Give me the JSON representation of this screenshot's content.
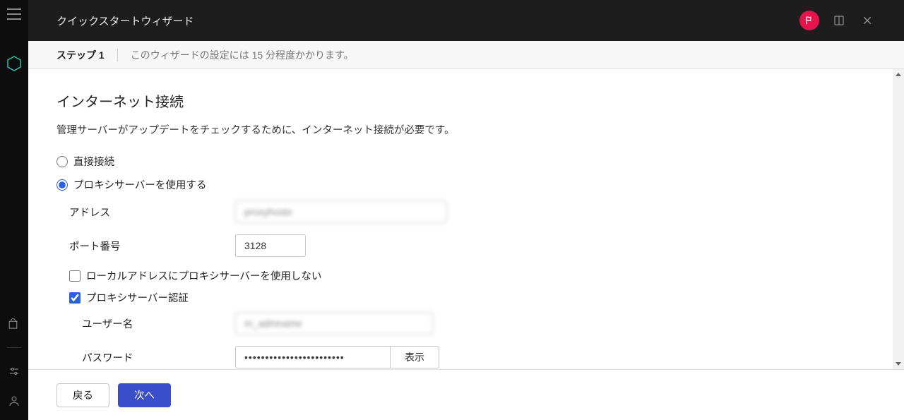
{
  "header": {
    "title": "クイックスタートウィザード"
  },
  "steps": {
    "current": "ステップ 1",
    "hint": "このウィザードの設定には 15 分程度かかります。"
  },
  "section": {
    "title": "インターネット接続",
    "desc": "管理サーバーがアップデートをチェックするために、インターネット接続が必要です。"
  },
  "radio": {
    "direct": "直接接続",
    "proxy": "プロキシサーバーを使用する"
  },
  "fields": {
    "address_label": "アドレス",
    "address_value": "proxyhostx",
    "port_label": "ポート番号",
    "port_value": "3128",
    "bypass_local": "ローカルアドレスにプロキシサーバーを使用しない",
    "proxy_auth": "プロキシサーバー認証",
    "user_label": "ユーザー名",
    "user_value": "m_admname",
    "pass_label": "パスワード",
    "pass_value": "••••••••••••••••••••••••",
    "show_label": "表示"
  },
  "footer": {
    "back": "戻る",
    "next": "次へ"
  }
}
